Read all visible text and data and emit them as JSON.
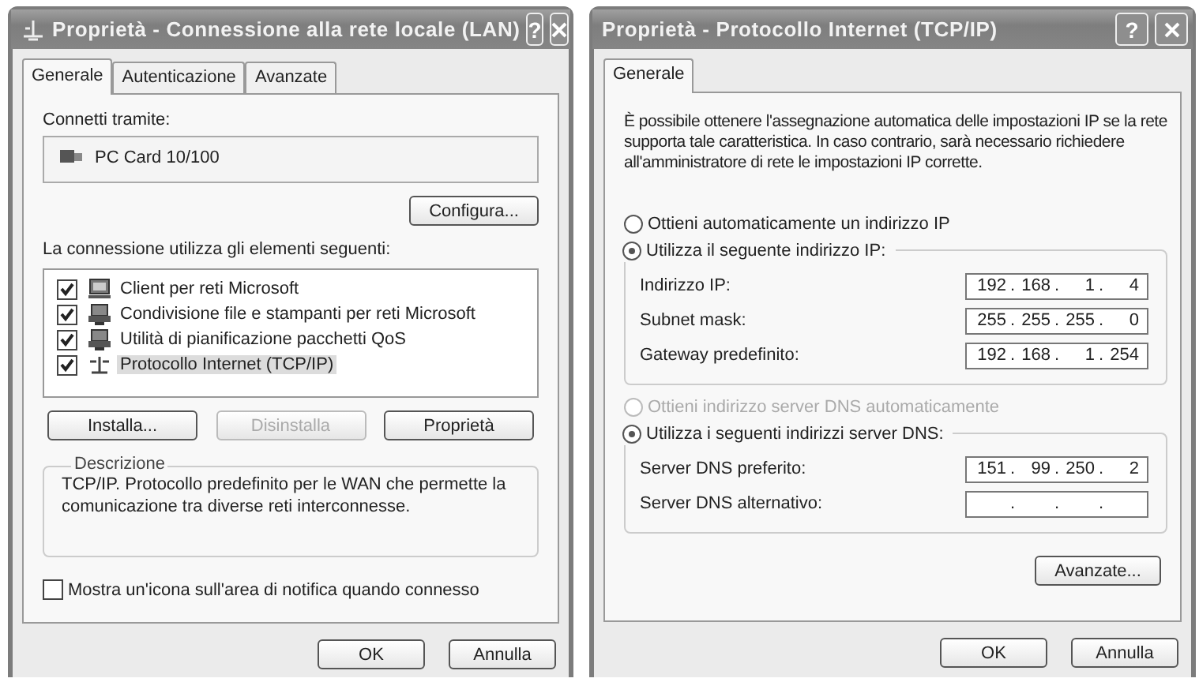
{
  "lan_dialog": {
    "title": "Proprietà - Connessione alla rete locale (LAN)",
    "help": "?",
    "tabs": [
      {
        "label": "Generale",
        "selected": true
      },
      {
        "label": "Autenticazione",
        "selected": false
      },
      {
        "label": "Avanzate",
        "selected": false
      }
    ],
    "connect_via_label": "Connetti tramite:",
    "adapter": "PC Card 10/100",
    "configure_button": "Configura...",
    "components_label": "La connessione utilizza gli elementi seguenti:",
    "components": [
      {
        "kind": "client",
        "label": "Client per reti Microsoft",
        "checked": true,
        "selected": false
      },
      {
        "kind": "service",
        "label": "Condivisione file e stampanti per reti Microsoft",
        "checked": true,
        "selected": false
      },
      {
        "kind": "service",
        "label": "Utilità di pianificazione pacchetti QoS",
        "checked": true,
        "selected": false
      },
      {
        "kind": "protocol",
        "label": "Protocollo Internet (TCP/IP)",
        "checked": true,
        "selected": true
      }
    ],
    "component_buttons": [
      {
        "label": "Installa...",
        "disabled": false
      },
      {
        "label": "Disinstalla",
        "disabled": true
      },
      {
        "label": "Proprietà",
        "disabled": false
      }
    ],
    "description": {
      "title": "Descrizione",
      "text": "TCP/IP. Protocollo predefinito per le WAN che permette la comunicazione tra diverse reti interconnesse."
    },
    "notify_checkbox": {
      "label": "Mostra un'icona sull'area di notifica quando connesso",
      "checked": false
    },
    "footer_buttons": [
      {
        "label": "OK"
      },
      {
        "label": "Annulla"
      }
    ]
  },
  "tcpip_dialog": {
    "title": "Proprietà - Protocollo Internet (TCP/IP)",
    "help": "?",
    "tabs": [
      {
        "label": "Generale",
        "selected": true
      }
    ],
    "intro": "È possibile ottenere l'assegnazione automatica delle impostazioni IP se la rete supporta tale caratteristica. In caso contrario, sarà necessario richiedere all'amministratore di rete le impostazioni IP corrette.",
    "sections": [
      {
        "auto_option": {
          "label": "Ottieni automaticamente un indirizzo IP",
          "selected": false,
          "disabled": false
        },
        "manual_option": {
          "label": "Utilizza il seguente indirizzo IP:",
          "selected": true,
          "disabled": false
        },
        "fields": [
          {
            "label": "Indirizzo IP:",
            "value": "192 . 168 . 1 . 4"
          },
          {
            "label": "Subnet mask:",
            "value": "255 . 255 . 255 . 0"
          },
          {
            "label": "Gateway predefinito:",
            "value": "192 . 168 . 1 . 254"
          }
        ]
      },
      {
        "auto_option": {
          "label": "Ottieni indirizzo server DNS automaticamente",
          "selected": false,
          "disabled": true
        },
        "manual_option": {
          "label": "Utilizza i seguenti indirizzi server DNS:",
          "selected": true,
          "disabled": false
        },
        "fields": [
          {
            "label": "Server DNS preferito:",
            "value": "151 . 99 . 250 . 2"
          },
          {
            "label": "Server DNS alternativo:",
            "value": ". . ."
          }
        ]
      }
    ],
    "advanced_button": "Avanzate...",
    "footer_buttons": [
      {
        "label": "OK"
      },
      {
        "label": "Annulla"
      }
    ]
  }
}
